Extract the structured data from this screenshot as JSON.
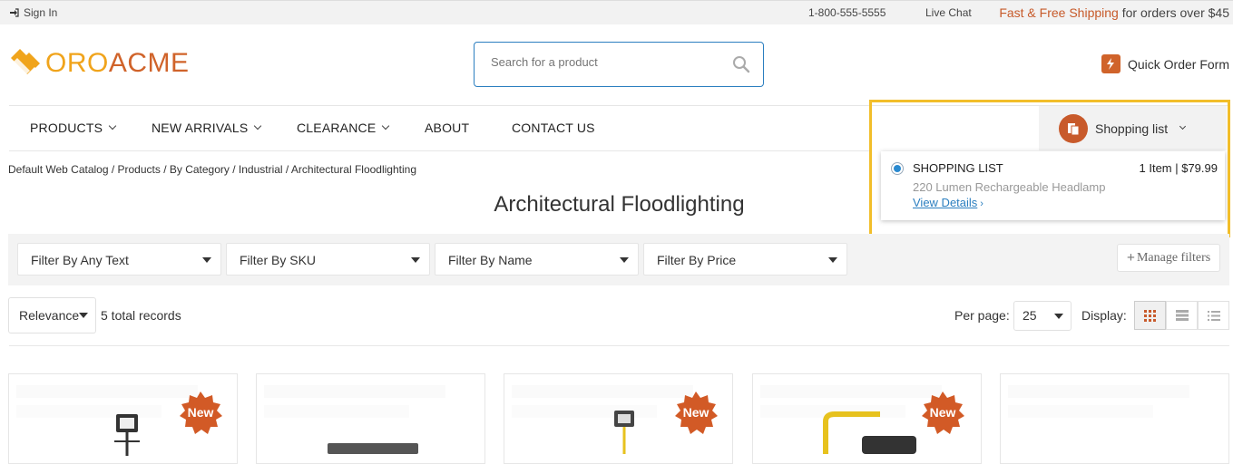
{
  "topbar": {
    "signin": "Sign In",
    "phone": "1-800-555-5555",
    "live_chat": "Live Chat",
    "shipping_highlight": "Fast & Free Shipping",
    "shipping_rest": " for orders over $45"
  },
  "logo": {
    "part1": "ORO",
    "part2": "ACME"
  },
  "search": {
    "placeholder": "Search for a product"
  },
  "quick_order": {
    "label": "Quick Order Form"
  },
  "nav": [
    {
      "label": "PRODUCTS"
    },
    {
      "label": "NEW ARRIVALS"
    },
    {
      "label": "CLEARANCE"
    },
    {
      "label": "ABOUT"
    },
    {
      "label": "CONTACT US"
    }
  ],
  "shopping_list": {
    "button_label": "Shopping list",
    "list_name": "SHOPPING LIST",
    "summary": "1 Item | $79.99",
    "product": "220 Lumen Rechargeable Headlamp",
    "details_link": "View Details"
  },
  "breadcrumb": "Default Web Catalog / Products / By Category / Industrial / Architectural Floodlighting",
  "page_title": "Architectural Floodlighting",
  "filters": [
    {
      "label": "Filter By Any Text"
    },
    {
      "label": "Filter By SKU"
    },
    {
      "label": "Filter By Name"
    },
    {
      "label": "Filter By Price"
    }
  ],
  "manage_filters": "Manage filters",
  "sorting": {
    "selected": "Relevance"
  },
  "total_records": "5 total records",
  "per_page": {
    "label": "Per page:",
    "value": "25"
  },
  "display": {
    "label": "Display:",
    "modes": [
      "grid-icon",
      "list-icon",
      "compact-list-icon"
    ],
    "active": "grid-icon"
  },
  "products": [
    {
      "badge": "New"
    },
    {
      "badge": ""
    },
    {
      "badge": "New"
    },
    {
      "badge": "New"
    },
    {
      "badge": ""
    }
  ],
  "colors": {
    "brand_orange": "#d0632a",
    "brand_yellow": "#f0a41c",
    "link_blue": "#2c7fc0",
    "highlight": "#f2be2a"
  }
}
